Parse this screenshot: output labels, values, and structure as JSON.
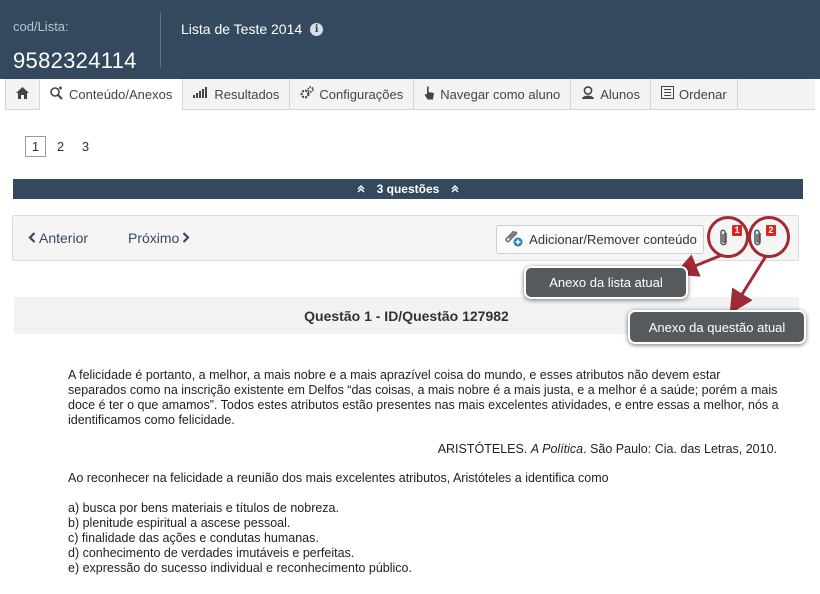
{
  "header": {
    "code_label": "cod/Lista:",
    "code_value": "9582324114",
    "list_title": "Lista de Teste 2014"
  },
  "tabs": [
    {
      "icon": "home-icon",
      "label": ""
    },
    {
      "icon": "content-icon",
      "label": "Conteúdo/Anexos"
    },
    {
      "icon": "results-icon",
      "label": "Resultados"
    },
    {
      "icon": "settings-icon",
      "label": "Configurações"
    },
    {
      "icon": "pointer-icon",
      "label": "Navegar como aluno"
    },
    {
      "icon": "students-icon",
      "label": "Alunos"
    },
    {
      "icon": "order-icon",
      "label": "Ordenar"
    }
  ],
  "pagination": [
    "1",
    "2",
    "3"
  ],
  "questions_bar": {
    "label": "3 questões"
  },
  "navigation": {
    "prev_label": "Anterior",
    "next_label": "Próximo",
    "add_content_label": "Adicionar/Remover conteúdo",
    "list_attachment_count": "1",
    "question_attachment_count": "2"
  },
  "annotations": {
    "list_attachment": "Anexo da lista atual",
    "question_attachment": "Anexo da questão atual"
  },
  "question": {
    "title": "Questão 1 - ID/Questão 127982",
    "paragraph": "A felicidade é portanto, a melhor, a mais nobre e a mais aprazível coisa do mundo, e esses atributos não devem estar separados como na inscrição existente em Delfos “das coisas, a mais nobre é a mais justa, e a melhor é a saúde; porém a mais doce é ter o que amamos”. Todos estes atributos estão presentes nas mais excelentes atividades, e entre essas a melhor, nós a identificamos como felicidade.",
    "citation_author": "ARISTÓTELES.",
    "citation_work": "A Política",
    "citation_rest": ". São Paulo: Cia. das Letras, 2010.",
    "stem": "Ao reconhecer na felicidade a reunião dos mais excelentes atributos, Aristóteles a identifica como",
    "options": [
      "a) busca por bens materiais e títulos de nobreza.",
      "b) plenitude espiritual a ascese pessoal.",
      "c) finalidade das ações e condutas humanas.",
      "d) conhecimento de verdades imutáveis e perfeitas.",
      "e) expressão do sucesso individual e reconhecimento público."
    ]
  },
  "colors": {
    "header_bg": "#34495e",
    "badge": "#d9261c",
    "ring": "#a12b35"
  }
}
